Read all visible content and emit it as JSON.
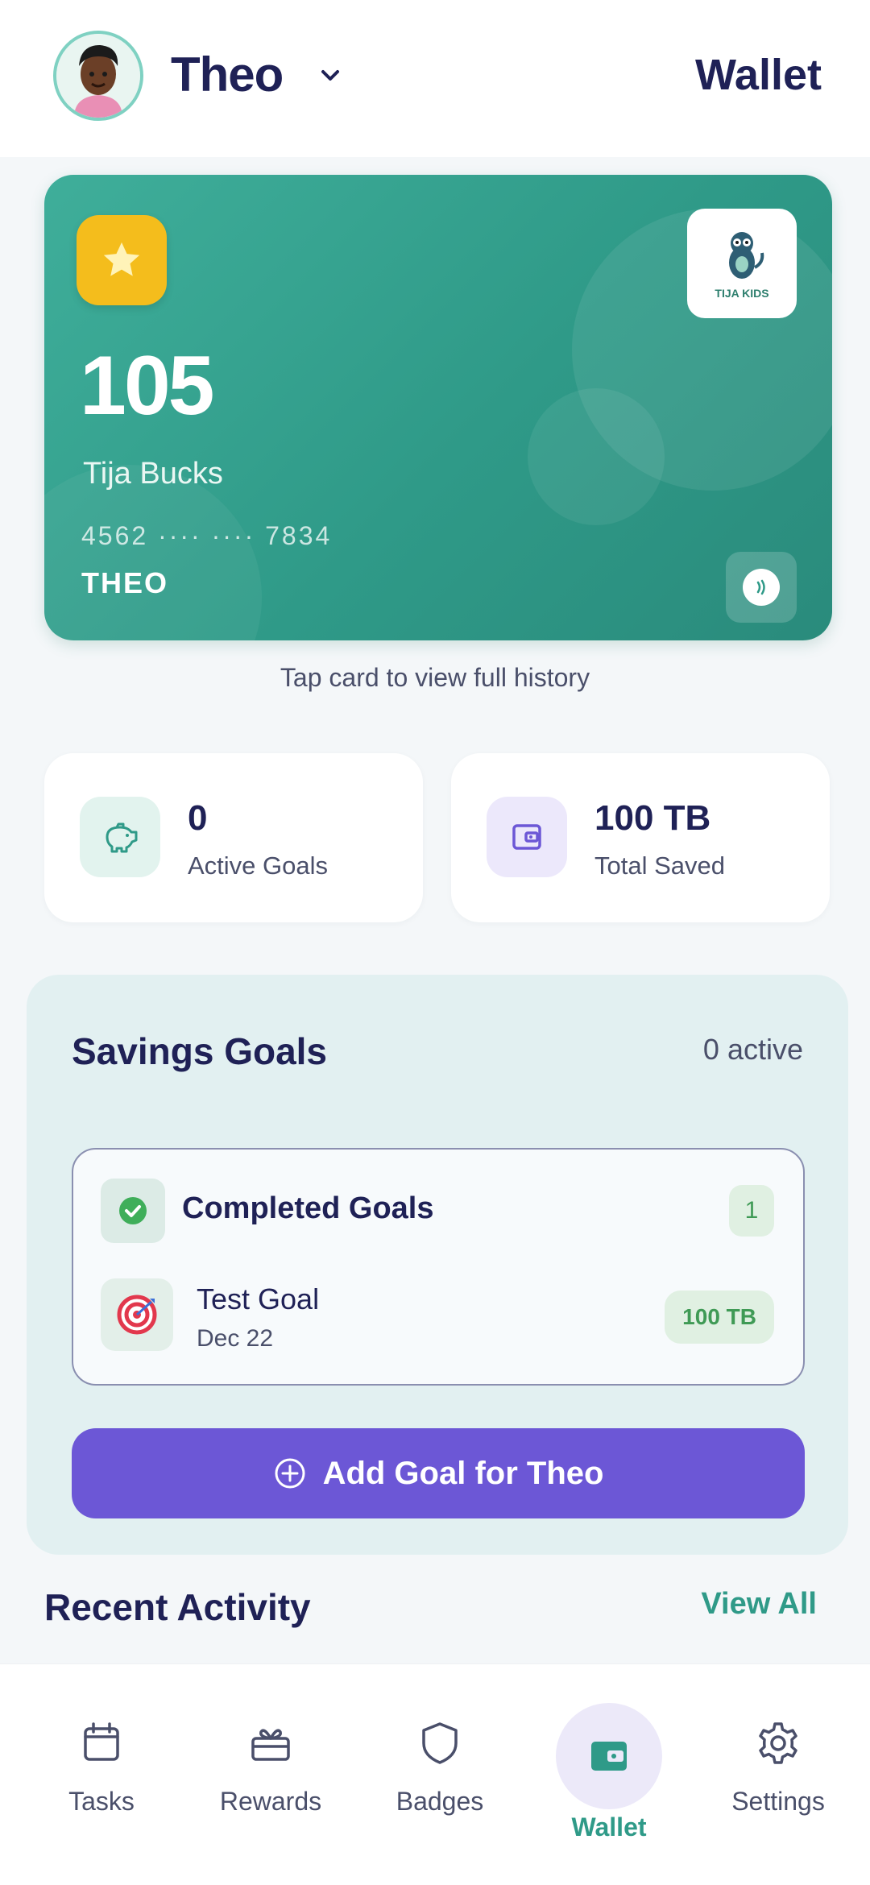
{
  "header": {
    "profile_name": "Theo",
    "title": "Wallet"
  },
  "card": {
    "balance": "105",
    "currency": "Tija Bucks",
    "number": "4562 ···· ···· 7834",
    "holder": "THEO",
    "hint": "Tap card to view full history",
    "logo_text": "TIJA KIDS",
    "colors": {
      "card": "#2f9a88",
      "star": "#f4bd1c"
    }
  },
  "stats": [
    {
      "value": "0",
      "label": "Active Goals",
      "icon": "piggy-bank-icon"
    },
    {
      "value": "100 TB",
      "label": "Total Saved",
      "icon": "wallet-icon"
    }
  ],
  "savings": {
    "title": "Savings Goals",
    "count": "0 active",
    "completed": {
      "title": "Completed Goals",
      "count": "1",
      "goals": [
        {
          "name": "Test Goal",
          "date": "Dec 22",
          "amount": "100 TB",
          "icon": "target-icon"
        }
      ]
    },
    "add_button": "Add Goal for Theo",
    "accent": "#6c57d6"
  },
  "recent": {
    "title": "Recent Activity",
    "view_all": "View All"
  },
  "nav": [
    {
      "label": "Tasks",
      "icon": "calendar-icon"
    },
    {
      "label": "Rewards",
      "icon": "gift-icon"
    },
    {
      "label": "Badges",
      "icon": "shield-icon"
    },
    {
      "label": "Wallet",
      "icon": "wallet-icon",
      "active": true
    },
    {
      "label": "Settings",
      "icon": "gear-icon"
    }
  ]
}
